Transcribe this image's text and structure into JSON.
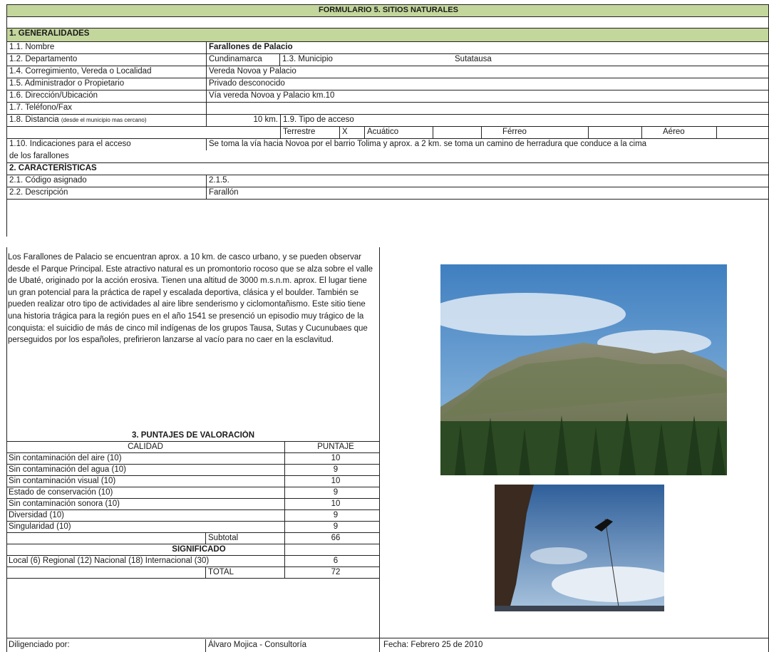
{
  "form": {
    "title": "FORMULARIO 5. SITIOS NATURALES",
    "section1": "1. GENERALIDADES",
    "nombre_label": "1.1. Nombre",
    "nombre_value": "Farallones de Palacio",
    "departamento_label": "1.2. Departamento",
    "departamento_value": "Cundinamarca",
    "municipio_label": "1.3. Municipio",
    "municipio_value": "Sutatausa",
    "corregimiento_label": "1.4. Corregimiento, Vereda o Localidad",
    "corregimiento_value": "Vereda Novoa y Palacio",
    "administrador_label": "1.5. Administrador o Propietario",
    "administrador_value": "Privado desconocido",
    "direccion_label": "1.6. Dirección/Ubicación",
    "direccion_value": "Vía vereda Novoa y Palacio km.10",
    "telefono_label": "1.7. Teléfono/Fax",
    "distancia_label": "1.8. Distancia",
    "distancia_note": "(desde el municipio mas cercano)",
    "distancia_value": "10 km.",
    "tipo_acceso_label": "1.9. Tipo de acceso",
    "acceso_terrestre": "Terrestre",
    "acceso_terrestre_mark": "X",
    "acceso_acuatico": "Acuático",
    "acceso_ferreo": "Férreo",
    "acceso_aereo": "Aéreo",
    "indicaciones_label": "1.10. Indicaciones para el acceso",
    "indicaciones_value": "Se toma la vía hacia Novoa por el barrio Tolima y aprox. a 2 km. se toma un camino de herradura que conduce a la cima",
    "indicaciones_value2": "de los farallones",
    "section2": "2. CARACTERÍSTICAS",
    "codigo_label": "2.1. Código asignado",
    "codigo_value": "2.1.5.",
    "descripcion_label": "2.2. Descripción",
    "descripcion_value": "Farallón",
    "descripcion_text": "Los Farallones de Palacio se encuentran aprox. a 10 km. de casco urbano, y se pueden observar desde el Parque Principal. Este atractivo natural es un promontorio rocoso que se alza sobre el valle de Ubaté, originado por la acción erosiva. Tienen una altitud de 3000 m.s.n.m. aprox. El lugar tiene un gran potencial para la práctica de rapel y escalada deportiva, clásica y el boulder. También se pueden realizar otro tipo de actividades al aire libre senderismo y ciclomontañismo. Este sitio tiene una historia trágica para la región pues en el año 1541 se presenció un episodio muy trágico de la conquista: el suicidio de más de cinco mil indígenas de los grupos Tausa, Sutas y Cucunubaes que perseguidos por los españoles, prefirieron lanzarse al vacío para no caer en la esclavitud."
  },
  "ratings": {
    "title": "3. PUNTAJES DE VALORACIÓN",
    "col_calidad": "CALIDAD",
    "col_puntaje": "PUNTAJE",
    "items": [
      {
        "label": "Sin contaminación del aire (10)",
        "score": "10"
      },
      {
        "label": "Sin contaminación del agua (10)",
        "score": "9"
      },
      {
        "label": "Sin contaminación visual (10)",
        "score": "10"
      },
      {
        "label": "Estado de conservación (10)",
        "score": "9"
      },
      {
        "label": "Sin contaminación sonora (10)",
        "score": "10"
      },
      {
        "label": "Diversidad (10)",
        "score": "9"
      },
      {
        "label": "Singularidad (10)",
        "score": "9"
      }
    ],
    "subtotal_label": "Subtotal",
    "subtotal_value": "66",
    "significado_title": "SIGNIFICADO",
    "significado_label": "Local (6)  Regional (12)  Nacional (18)  Internacional (30)",
    "significado_value": "6",
    "total_label": "TOTAL",
    "total_value": "72"
  },
  "footer": {
    "diligenciado_label": "Diligenciado por:",
    "diligenciado_value": "Álvaro Mojica - Consultoría",
    "fecha": "Fecha: Febrero 25 de 2010"
  },
  "colors": {
    "header_bg": "#c3d69b",
    "border": "#222222"
  }
}
